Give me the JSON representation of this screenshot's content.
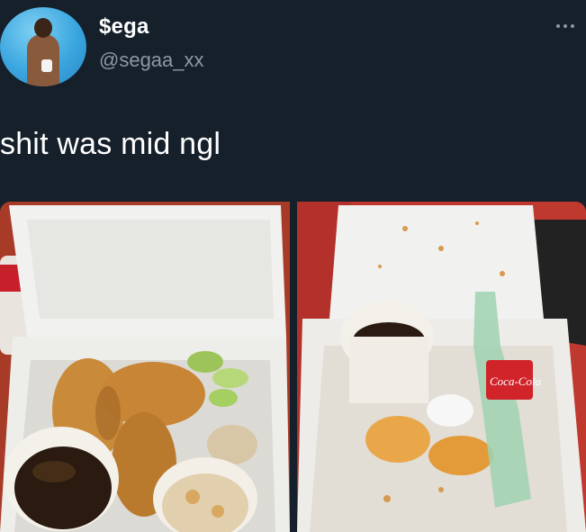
{
  "tweet": {
    "author": {
      "display_name": "$ega",
      "handle": "@segaa_xx"
    },
    "text": "shit was mid ngl",
    "more_icon": "more-horizontal-icon",
    "media": [
      {
        "label": "photo-full-takeout"
      },
      {
        "label": "photo-finished-takeout",
        "bottle_label": "Coca-Cola"
      }
    ]
  },
  "colors": {
    "background": "#15202b",
    "primary_text": "#ffffff",
    "secondary_text": "#8b98a5"
  }
}
